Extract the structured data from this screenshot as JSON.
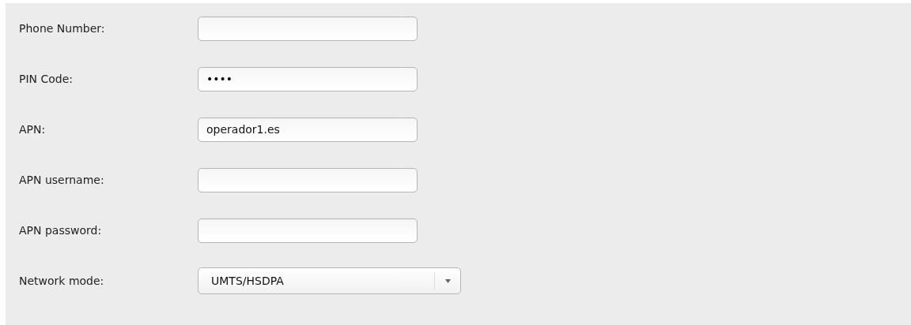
{
  "fields": [
    {
      "kind": "text",
      "label": "Phone Number:"
    },
    {
      "kind": "text",
      "label": "PIN Code:",
      "value": "••••"
    },
    {
      "kind": "text",
      "label": "APN:",
      "value": "operador1.es"
    },
    {
      "kind": "text",
      "label": "APN username:"
    },
    {
      "kind": "text",
      "label": "APN password:"
    },
    {
      "kind": "select",
      "label": "Network mode:",
      "value": "UMTS/HSDPA"
    }
  ]
}
